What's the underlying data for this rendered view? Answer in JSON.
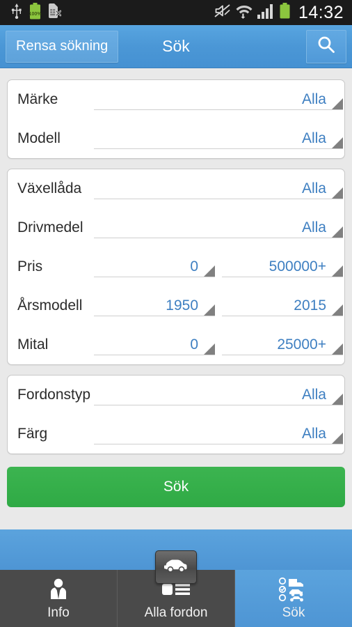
{
  "statusbar": {
    "icons_left": [
      "usb-icon",
      "battery-100-icon",
      "sim-card-error-icon"
    ],
    "battery_text": "100%",
    "icons_right": [
      "mute-icon",
      "wifi-transfer-icon",
      "signal-bars-icon",
      "battery-icon"
    ],
    "clock": "14:32"
  },
  "actionbar": {
    "clear_label": "Rensa sökning",
    "title": "Sök",
    "search_icon": "magnifier-icon"
  },
  "groups": [
    {
      "rows": [
        {
          "label": "Märke",
          "type": "single",
          "value": "Alla"
        },
        {
          "label": "Modell",
          "type": "single",
          "value": "Alla"
        }
      ]
    },
    {
      "rows": [
        {
          "label": "Växellåda",
          "type": "single",
          "value": "Alla"
        },
        {
          "label": "Drivmedel",
          "type": "single",
          "value": "Alla"
        },
        {
          "label": "Pris",
          "type": "range",
          "min": "0",
          "max": "500000+"
        },
        {
          "label": "Årsmodell",
          "type": "range",
          "min": "1950",
          "max": "2015"
        },
        {
          "label": "Mital",
          "type": "range",
          "min": "0",
          "max": "25000+"
        }
      ]
    },
    {
      "rows": [
        {
          "label": "Fordonstyp",
          "type": "single",
          "value": "Alla"
        },
        {
          "label": "Färg",
          "type": "single",
          "value": "Alla"
        }
      ]
    }
  ],
  "submit": {
    "label": "Sök"
  },
  "fab": {
    "icon": "car-icon"
  },
  "tabbar": {
    "items": [
      {
        "label": "Info",
        "icon": "person-info-icon",
        "active": false
      },
      {
        "label": "Alla fordon",
        "icon": "list-icon",
        "active": false
      },
      {
        "label": "Sök",
        "icon": "vehicle-filter-icon",
        "active": true
      }
    ]
  },
  "colors": {
    "accent_blue": "#4e95d4",
    "value_blue": "#3e7fc1",
    "submit_green": "#2faa45",
    "tab_dark": "#4a4a4a",
    "page_bg": "#e9e9e9",
    "status_bg": "#1b1b1b"
  }
}
